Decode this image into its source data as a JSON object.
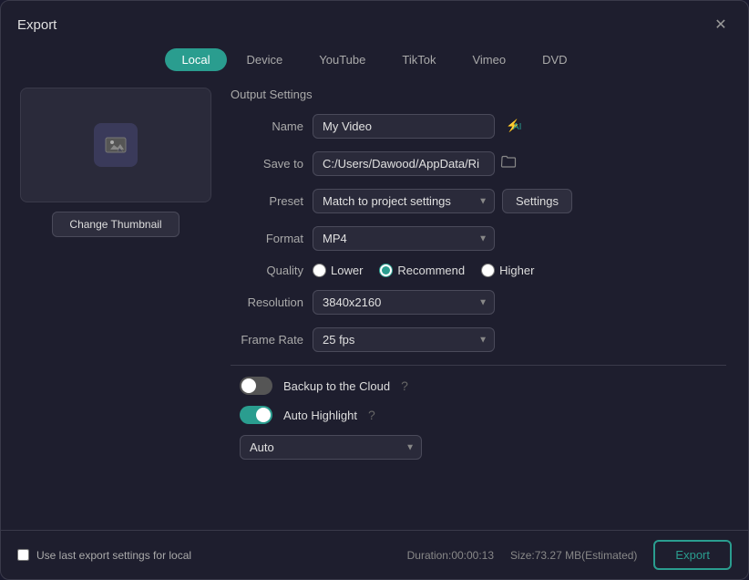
{
  "dialog": {
    "title": "Export",
    "close_label": "✕"
  },
  "tabs": [
    {
      "id": "local",
      "label": "Local",
      "active": true
    },
    {
      "id": "device",
      "label": "Device",
      "active": false
    },
    {
      "id": "youtube",
      "label": "YouTube",
      "active": false
    },
    {
      "id": "tiktok",
      "label": "TikTok",
      "active": false
    },
    {
      "id": "vimeo",
      "label": "Vimeo",
      "active": false
    },
    {
      "id": "dvd",
      "label": "DVD",
      "active": false
    }
  ],
  "thumbnail": {
    "change_label": "Change Thumbnail"
  },
  "output_settings": {
    "section_title": "Output Settings",
    "name_label": "Name",
    "name_value": "My Video",
    "save_to_label": "Save to",
    "save_to_value": "C:/Users/Dawood/AppData/Ri",
    "preset_label": "Preset",
    "preset_value": "Match to project settings",
    "settings_label": "Settings",
    "format_label": "Format",
    "format_value": "MP4",
    "quality_label": "Quality",
    "quality_options": [
      {
        "id": "lower",
        "label": "Lower",
        "checked": false
      },
      {
        "id": "recommend",
        "label": "Recommend",
        "checked": true
      },
      {
        "id": "higher",
        "label": "Higher",
        "checked": false
      }
    ],
    "resolution_label": "Resolution",
    "resolution_value": "3840x2160",
    "framerate_label": "Frame Rate",
    "framerate_value": "25 fps",
    "backup_label": "Backup to the Cloud",
    "backup_enabled": false,
    "autohighlight_label": "Auto Highlight",
    "autohighlight_enabled": true,
    "auto_label": "Auto"
  },
  "footer": {
    "checkbox_label": "Use last export settings for local",
    "duration_label": "Duration:00:00:13",
    "size_label": "Size:73.27 MB(Estimated)",
    "export_label": "Export"
  }
}
